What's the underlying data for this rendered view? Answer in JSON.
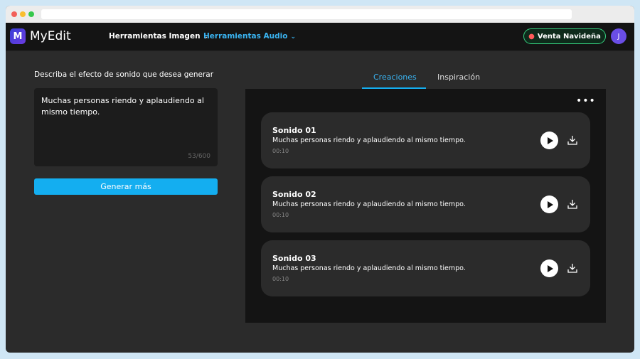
{
  "app": {
    "logo_letter": "M",
    "name": "MyEdit",
    "brand_color": "#4b3fe0"
  },
  "nav": {
    "items": [
      {
        "label": "Herramientas Imagen",
        "active": false
      },
      {
        "label": "Herramientas Audio",
        "active": true
      }
    ],
    "promo_label": "Venta Navideña",
    "promo_icon": "ornament-icon",
    "avatar_initial": "J",
    "accent_color": "#3ab4f2"
  },
  "prompt": {
    "label": "Describa el efecto de sonido que desea generar",
    "value": "Muchas personas riendo y aplaudiendo al mismo tiempo.",
    "char_count": "53/600",
    "generate_label": "Generar más"
  },
  "tabs": [
    {
      "label": "Creaciones",
      "active": true
    },
    {
      "label": "Inspiración",
      "active": false
    }
  ],
  "results": {
    "more_label": "•••",
    "items": [
      {
        "title": "Sonido 01",
        "description": "Muchas personas riendo y aplaudiendo al mismo tiempo.",
        "duration": "00:10"
      },
      {
        "title": "Sonido 02",
        "description": "Muchas personas riendo y aplaudiendo al mismo tiempo.",
        "duration": "00:10"
      },
      {
        "title": "Sonido 03",
        "description": "Muchas personas riendo y aplaudiendo al mismo tiempo.",
        "duration": "00:10"
      }
    ]
  }
}
